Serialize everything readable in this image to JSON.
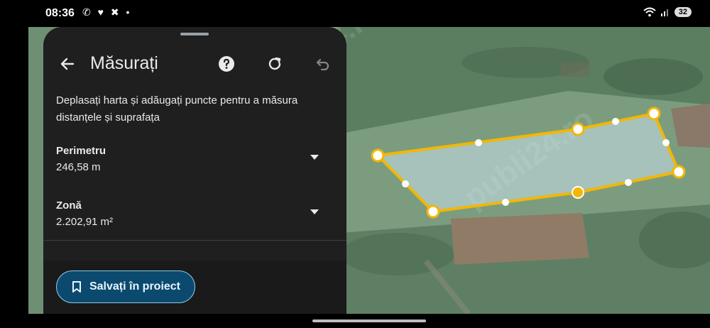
{
  "status": {
    "time": "08:36",
    "left_icons": "✆ ♥ ✖ •",
    "battery": "32"
  },
  "panel": {
    "title": "Măsurați",
    "instruction": "Deplasați harta și adăugați puncte pentru a măsura distanțele și suprafața",
    "perimeter_label": "Perimetru",
    "perimeter_value": "246,58 m",
    "area_label": "Zonă",
    "area_value": "2.202,91 m²",
    "save_label": "Salvați în proiect"
  },
  "watermark": "publi24.ro",
  "icons": {
    "back": "arrow-left-icon",
    "help": "help-circle-icon",
    "refresh": "refresh-icon",
    "undo": "undo-icon",
    "save": "bookmark-icon"
  },
  "colors": {
    "polygon_stroke": "#f2b705",
    "save_button_bg": "#0b4a6e",
    "panel_bg": "#1f1f1f"
  }
}
